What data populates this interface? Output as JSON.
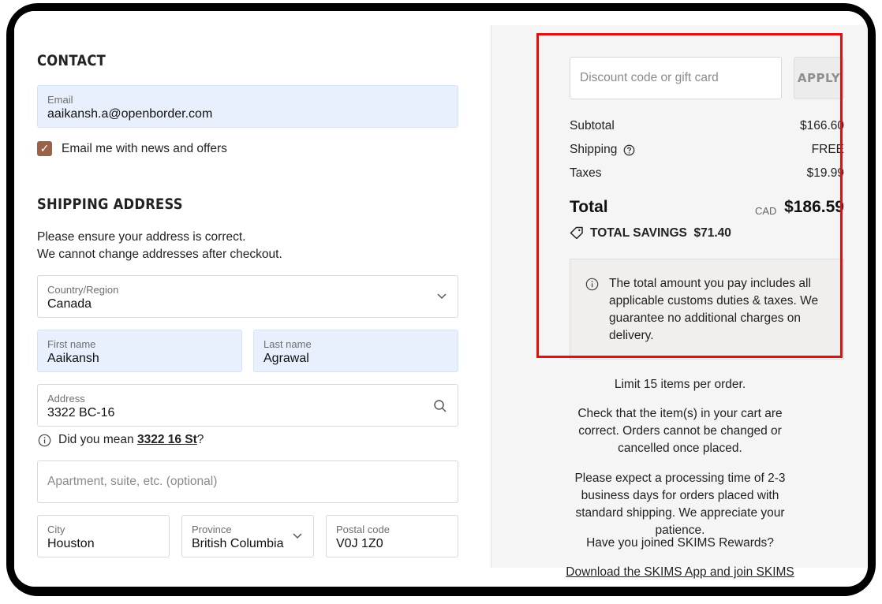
{
  "contact": {
    "title": "CONTACT",
    "email_label": "Email",
    "email_value": "aaikansh.a@openborder.com",
    "newsletter_label": "Email me with news and offers"
  },
  "shipping": {
    "title": "SHIPPING ADDRESS",
    "note_line1": "Please ensure your address is correct.",
    "note_line2": "We cannot change addresses after checkout.",
    "country_label": "Country/Region",
    "country_value": "Canada",
    "first_name_label": "First name",
    "first_name_value": "Aaikansh",
    "last_name_label": "Last name",
    "last_name_value": "Agrawal",
    "address_label": "Address",
    "address_value": "3322 BC-16",
    "suggestion_prefix": "Did you mean ",
    "suggestion_value": "3322 16 St",
    "suggestion_suffix": "?",
    "apartment_placeholder": "Apartment, suite, etc. (optional)",
    "city_label": "City",
    "city_value": "Houston",
    "province_label": "Province",
    "province_value": "British Columbia",
    "postal_label": "Postal code",
    "postal_value": "V0J 1Z0"
  },
  "summary": {
    "discount_placeholder": "Discount code or gift card",
    "apply_label": "APPLY",
    "subtotal_label": "Subtotal",
    "subtotal_value": "$166.60",
    "shipping_label": "Shipping",
    "shipping_value": "FREE",
    "taxes_label": "Taxes",
    "taxes_value": "$19.99",
    "total_label": "Total",
    "currency": "CAD",
    "total_value": "$186.59",
    "savings_label": "TOTAL SAVINGS",
    "savings_value": "$71.40",
    "info_message": "The total amount you pay includes all applicable customs duties & taxes. We guarantee no additional charges on delivery.",
    "limit_note": "Limit 15 items per order.",
    "check_note": "Check that the item(s) in your cart are correct. Orders cannot be changed or cancelled once placed.",
    "processing_note": "Please expect a processing time of 2-3 business days for orders placed with standard shipping. We appreciate your patience.",
    "rewards_question": "Have you joined SKIMS Rewards?",
    "rewards_link": "Download the SKIMS App and join SKIMS"
  },
  "colors": {
    "accent_checkbox": "#9a6248",
    "highlight_border": "#e01010",
    "filled_field": "#e8f0fe"
  },
  "icons": [
    "chevron-down-icon",
    "search-icon",
    "info-icon",
    "help-circle-icon",
    "tag-icon",
    "check-icon"
  ]
}
